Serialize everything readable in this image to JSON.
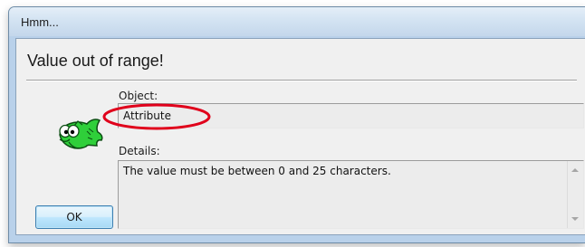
{
  "window": {
    "title": "Hmm..."
  },
  "dialog": {
    "headline": "Value out of range!",
    "object_label": "Object:",
    "object_value": "Attribute",
    "details_label": "Details:",
    "details_text": "The value must be between 0 and 25 characters.",
    "ok_label": "OK"
  },
  "icons": {
    "dialog_icon": "green-fish-icon",
    "annotation": "red-ellipse-highlight"
  },
  "colors": {
    "highlight": "#e0001b",
    "fish": "#2fcf3a"
  }
}
